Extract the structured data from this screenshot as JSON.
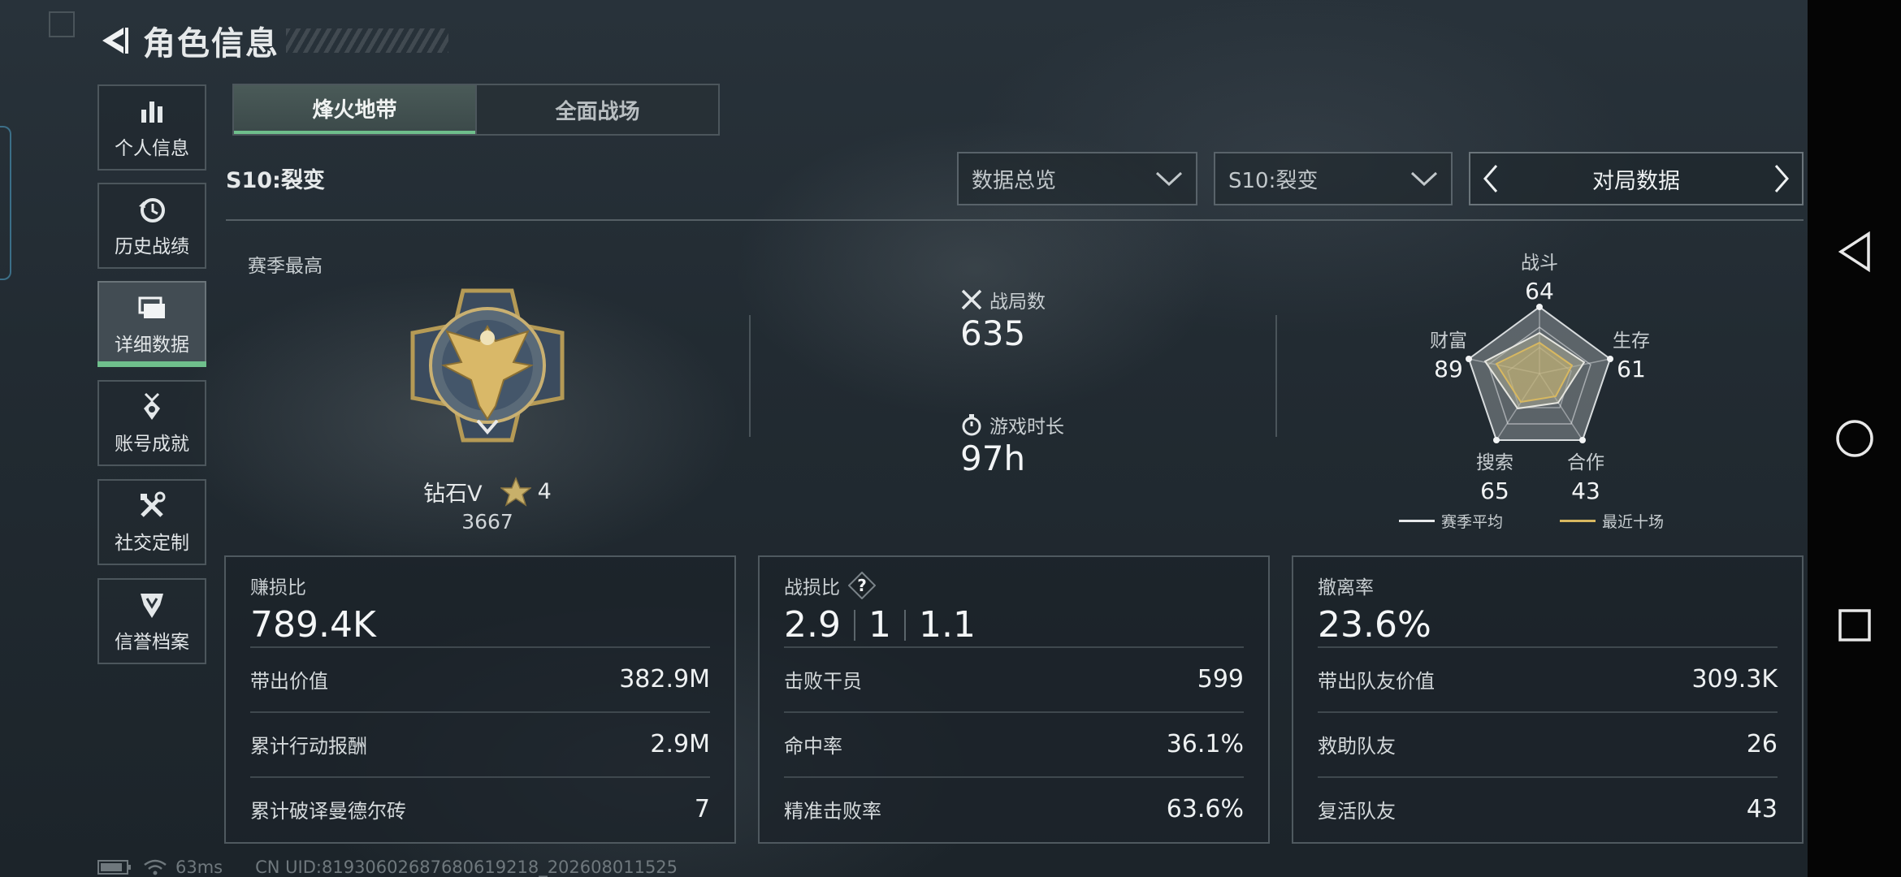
{
  "header": {
    "title": "角色信息"
  },
  "sidebar": {
    "items": [
      {
        "label": "个人信息",
        "icon": "bar-chart-icon"
      },
      {
        "label": "历史战绩",
        "icon": "history-icon"
      },
      {
        "label": "详细数据",
        "icon": "folder-icon",
        "active": true
      },
      {
        "label": "账号成就",
        "icon": "medal-icon"
      },
      {
        "label": "社交定制",
        "icon": "tools-icon"
      },
      {
        "label": "信誉档案",
        "icon": "shield-icon"
      }
    ]
  },
  "tabs": [
    {
      "label": "烽火地带",
      "active": true
    },
    {
      "label": "全面战场",
      "active": false
    }
  ],
  "season": {
    "label": "S10:裂变"
  },
  "filters": {
    "data_type": "数据总览",
    "season": "S10:裂变",
    "pager_label": "对局数据"
  },
  "rank": {
    "section_label": "赛季最高",
    "tier": "钻石V",
    "stars": "4",
    "score": "3667"
  },
  "summary": {
    "matches_label": "战局数",
    "matches_value": "635",
    "playtime_label": "游戏时长",
    "playtime_value": "97h"
  },
  "radar": {
    "axes": [
      {
        "label": "战斗",
        "value": "64"
      },
      {
        "label": "生存",
        "value": "61"
      },
      {
        "label": "合作",
        "value": "43"
      },
      {
        "label": "搜索",
        "value": "65"
      },
      {
        "label": "财富",
        "value": "89"
      }
    ],
    "legend_season": "赛季平均",
    "legend_recent": "最近十场"
  },
  "cards": {
    "profit": {
      "title": "赚损比",
      "value": "789.4K",
      "rows": [
        {
          "label": "带出价值",
          "value": "382.9M"
        },
        {
          "label": "累计行动报酬",
          "value": "2.9M"
        },
        {
          "label": "累计破译曼德尔砖",
          "value": "7"
        }
      ]
    },
    "combat": {
      "title": "战损比",
      "values": [
        "2.9",
        "1",
        "1.1"
      ],
      "rows": [
        {
          "label": "击败干员",
          "value": "599"
        },
        {
          "label": "命中率",
          "value": "36.1%"
        },
        {
          "label": "精准击败率",
          "value": "63.6%"
        }
      ]
    },
    "extract": {
      "title": "撤离率",
      "value": "23.6%",
      "rows": [
        {
          "label": "带出队友价值",
          "value": "309.3K"
        },
        {
          "label": "救助队友",
          "value": "26"
        },
        {
          "label": "复活队友",
          "value": "43"
        }
      ]
    }
  },
  "footer": {
    "ping": "63ms",
    "uid": "CN UID:81930602687680619218_202608011525"
  },
  "colors": {
    "accent_green": "#6fbf8c",
    "recent_gold": "#d8b860"
  }
}
